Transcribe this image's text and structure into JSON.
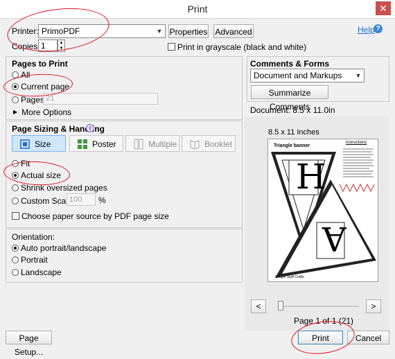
{
  "window": {
    "title": "Print"
  },
  "printer": {
    "label": "Printer:",
    "value": "PrimoPDF",
    "properties_label": "Properties",
    "advanced_label": "Advanced",
    "help_label": "Help"
  },
  "copies": {
    "label": "Copies:",
    "value": "1"
  },
  "grayscale": {
    "label": "Print in grayscale (black and white)"
  },
  "pages_to_print": {
    "title": "Pages to Print",
    "all_label": "All",
    "current_label": "Current page",
    "pages_label": "Pages",
    "pages_value": "21",
    "more_options_label": "More Options"
  },
  "sizing": {
    "title": "Page Sizing & Handling",
    "size_label": "Size",
    "poster_label": "Poster",
    "multiple_label": "Multiple",
    "booklet_label": "Booklet",
    "fit_label": "Fit",
    "actual_label": "Actual size",
    "shrink_label": "Shrink oversized pages",
    "custom_label": "Custom Scale:",
    "custom_value": "100",
    "percent": "%",
    "paper_source_label": "Choose paper source by PDF page size"
  },
  "orientation": {
    "title": "Orientation:",
    "auto_label": "Auto portrait/landscape",
    "portrait_label": "Portrait",
    "landscape_label": "Landscape"
  },
  "comments": {
    "title": "Comments & Forms",
    "value": "Document and Markups",
    "summarize_label": "Summarize Comments"
  },
  "preview": {
    "document_size": "Document: 8.5 x 11.0in",
    "paper_label": "8.5 x 11 Inches",
    "banner_title": "Triangle banner",
    "instructions_title": "instructions",
    "letter_1": "H",
    "letter_2": "A",
    "footer_text": "Simple Stuff Crafts",
    "prev_label": "<",
    "next_label": ">",
    "page_info": "Page 1 of 1 (21)"
  },
  "footer": {
    "page_setup_label": "Page Setup...",
    "print_label": "Print",
    "cancel_label": "Cancel"
  },
  "colors": {
    "accent": "#1e6fc8",
    "annotation": "#e0141e",
    "active_tool": "#cfe6fb"
  }
}
